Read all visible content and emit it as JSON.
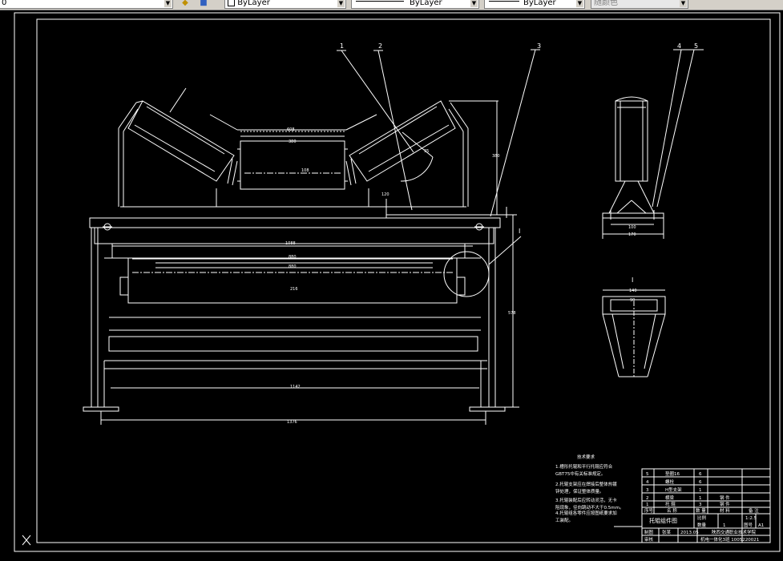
{
  "toolbar": {
    "layer_value": "0",
    "color_value": "ByLayer",
    "linetype_value": "ByLayer",
    "lineweight_value": "ByLayer",
    "plotstyle_value": "随颜色"
  },
  "drawing": {
    "balloons": [
      "1",
      "2",
      "3",
      "4",
      "5"
    ],
    "detail_label": "I",
    "dims": {
      "top_width": "608",
      "center_roller_len": "380",
      "center_roller_dia": "108",
      "roller_angle": "35",
      "height_top": "380",
      "small_dim": "120",
      "beam_width": "1088",
      "beam_inner_1": "880",
      "beam_inner_2": "880",
      "beam_depth": "216",
      "base_width": "1142",
      "overall_width": "1376",
      "overall_height": "578",
      "side_base_1": "100",
      "side_base_2": "170",
      "detail_top": "140",
      "detail_inner": "90"
    },
    "notes": {
      "title": "技术要求",
      "lines": [
        "1.槽形托辊和平行托辊应符合",
        "GBT75中有关标准规定。",
        "2.托辊支架应在焊接后整体热镀",
        "锌处理，保证整体质量。",
        "3.托辊装配后应转动灵活，无卡",
        "阻现象，径向跳动不大于0.5mm。",
        "4.托辊组各零件应按图纸要求加",
        "工装配。"
      ]
    },
    "bom": [
      {
        "seq": "5",
        "name": "垫圈16",
        "qty": "6",
        "material": ""
      },
      {
        "seq": "4",
        "name": "螺栓",
        "qty": "6",
        "material": ""
      },
      {
        "seq": "3",
        "name": "H型支架",
        "qty": "1",
        "material": ""
      },
      {
        "seq": "2",
        "name": "横梁",
        "qty": "1",
        "material": "钢 件"
      },
      {
        "seq": "1",
        "name": "托 辊",
        "qty": "3",
        "material": "钢 件"
      }
    ],
    "bom_headers": [
      "序号",
      "名 称",
      "数 量",
      "材 料",
      "备 注"
    ],
    "title_block": {
      "drawing_name": "托辊组件图",
      "scale_label": "比例",
      "scale_value": "1:2.5",
      "qty_label": "数量",
      "qty_value": "1",
      "sheet_label": "图号",
      "sheet_value": "A1",
      "material_label": "材料",
      "drawn_label": "制图",
      "drawn_name": "张某",
      "date": "2013.05",
      "check_label": "审核",
      "school": "陕西交通职业技术学院",
      "class_info": "机电一体化3班  1005220021"
    }
  }
}
